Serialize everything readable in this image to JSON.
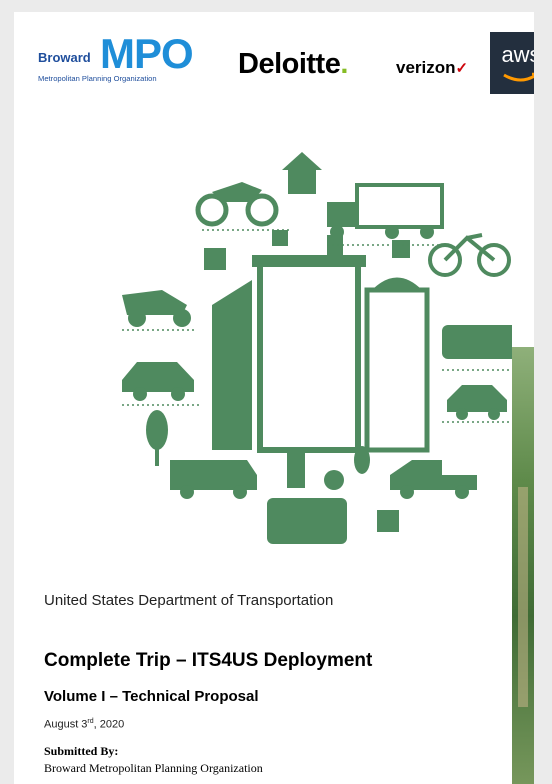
{
  "logos": {
    "mpo": {
      "broward": "Broward",
      "big": "MPO",
      "subtitle": "Metropolitan Planning Organization"
    },
    "deloitte": {
      "name": "Deloitte",
      "dot": "."
    },
    "verizon": {
      "name": "verizon",
      "check": "✓"
    },
    "aws": {
      "name": "aws"
    }
  },
  "document": {
    "department": "United States Department of Transportation",
    "title": "Complete Trip – ITS4US Deployment",
    "volume": "Volume I – Technical Proposal",
    "date_main": "August 3",
    "date_sup": "rd",
    "date_year": ", 2020",
    "submitted_label": "Submitted By:",
    "organization": "Broward Metropolitan Planning Organization"
  },
  "colors": {
    "illustration_green": "#4f8a5f",
    "mpo_blue": "#1f8ed8",
    "deloitte_green": "#86bc25",
    "verizon_red": "#cd040b",
    "aws_bg": "#232f3e"
  }
}
